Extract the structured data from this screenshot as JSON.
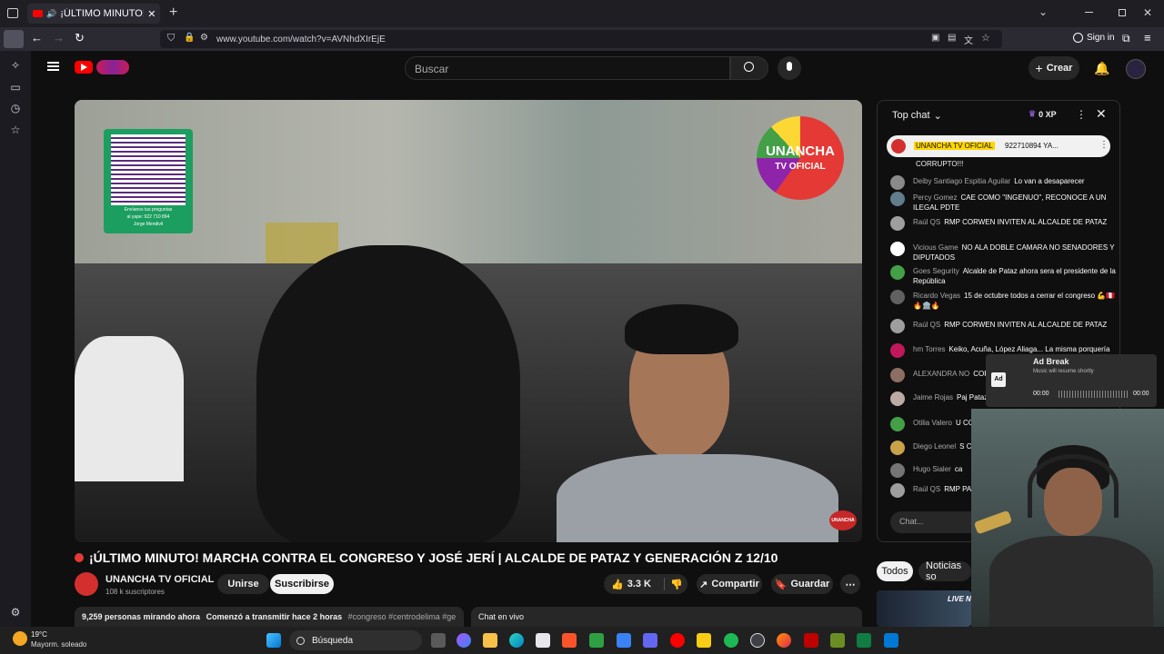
{
  "browser": {
    "tab_title": "¡ÚLTIMO MINUTO! MAR",
    "url": "www.youtube.com/watch?v=AVNhdXIrEjE",
    "sign_in": "Sign in"
  },
  "header": {
    "search_placeholder": "Buscar",
    "create_label": "Crear"
  },
  "video": {
    "qr_caption_1": "Envíanos tus preguntas",
    "qr_caption_2": "al yape: 922 710 894",
    "qr_caption_3": "Jorge Mendivil",
    "channel_watermark_1": "UNANCHA",
    "channel_watermark_2": "TV OFICIAL",
    "corner_watermark": "UNANCHA"
  },
  "title": "¡ÚLTIMO MINUTO! MARCHA CONTRA EL CONGRESO Y JOSÉ JERÍ | ALCALDE DE PATAZ Y GENERACIÓN Z 12/10",
  "channel": {
    "name": "UNANCHA TV OFICIAL",
    "subscribers": "108 k suscriptores",
    "join": "Unirse",
    "subscribe": "Suscribirse",
    "likes": "3.3 K",
    "share": "Compartir",
    "save": "Guardar"
  },
  "description": {
    "watching": "9,259 personas mirando ahora",
    "started": "Comenzó a transmitir hace 2 horas",
    "tags": "#congreso #centrodelima #ge"
  },
  "live_chat_label": "Chat en vivo",
  "chat": {
    "header": "Top chat",
    "xp": "0 XP",
    "pinned_name": "UNANCHA TV OFICIAL",
    "pinned_text": "922710894 YA...",
    "first_line": "CORRUPTO!!!",
    "input_placeholder": "Chat...",
    "messages": [
      {
        "name": "Deiby Santiago Espitia Aguilar",
        "text": "Lo van a desaparecer",
        "color": "#8a8a8a"
      },
      {
        "name": "Percy Gomez",
        "text": "CAE COMO \"INGENUO\", RECONOCE A UN ILEGAL PDTE",
        "color": "#607d8b"
      },
      {
        "name": "Raúl QS",
        "text": "RMP CORWEN INVITEN AL ALCALDE DE PATAZ",
        "color": "#9e9e9e"
      },
      {
        "name": "Vicious Game",
        "text": "NO ALA DOBLE CAMARA NO SENADORES Y DIPUTADOS",
        "color": "#ffffff"
      },
      {
        "name": "Goes Segurity",
        "text": "Alcalde de Pataz ahora sera el presidente de la República",
        "color": "#43a047"
      },
      {
        "name": "Ricardo Vegas",
        "text": "15 de octubre todos a cerrar el congreso 💪🇵🇪🔥🏛️🔥",
        "color": "#616161"
      },
      {
        "name": "Raúl QS",
        "text": "RMP CORWEN INVITEN AL ALCALDE DE PATAZ",
        "color": "#9e9e9e"
      },
      {
        "name": "hm Torres",
        "text": "Keiko, Acuña, López Aliaga... La misma porquería",
        "color": "#c2185b"
      },
      {
        "name": "ALEXANDRA NO",
        "text": "CORRUPTO!!!",
        "color": "#8d6e63"
      },
      {
        "name": "Jaime Rojas",
        "text": "Paj Pataz y la carretera",
        "color": "#bcaaa4"
      },
      {
        "name": "Otilia Valero",
        "text": "U CONGRESO",
        "color": "#43a047"
      },
      {
        "name": "Diego Leonel",
        "text": "S CAMBIO",
        "color": "#c9a24a"
      },
      {
        "name": "Hugo Sialer",
        "text": "ca",
        "color": "#757575"
      },
      {
        "name": "Raúl QS",
        "text": "RMP PATAZ",
        "color": "#9e9e9e"
      }
    ]
  },
  "ad_break": {
    "title": "Ad Break",
    "subtitle": "Music will resume shortly",
    "badge": "Ad",
    "time_start": "00:00",
    "time_end": "00:00"
  },
  "chips": {
    "all": "Todos",
    "news": "Noticias so"
  },
  "thumb_text": "LIVE NO",
  "taskbar": {
    "temp": "19°C",
    "weather": "Mayorm. soleado",
    "search": "Búsqueda"
  },
  "colors": {
    "yt_red": "#ff0000",
    "pinned_bg": "#f1f1f1",
    "pinned_highlight": "#ffd600"
  }
}
